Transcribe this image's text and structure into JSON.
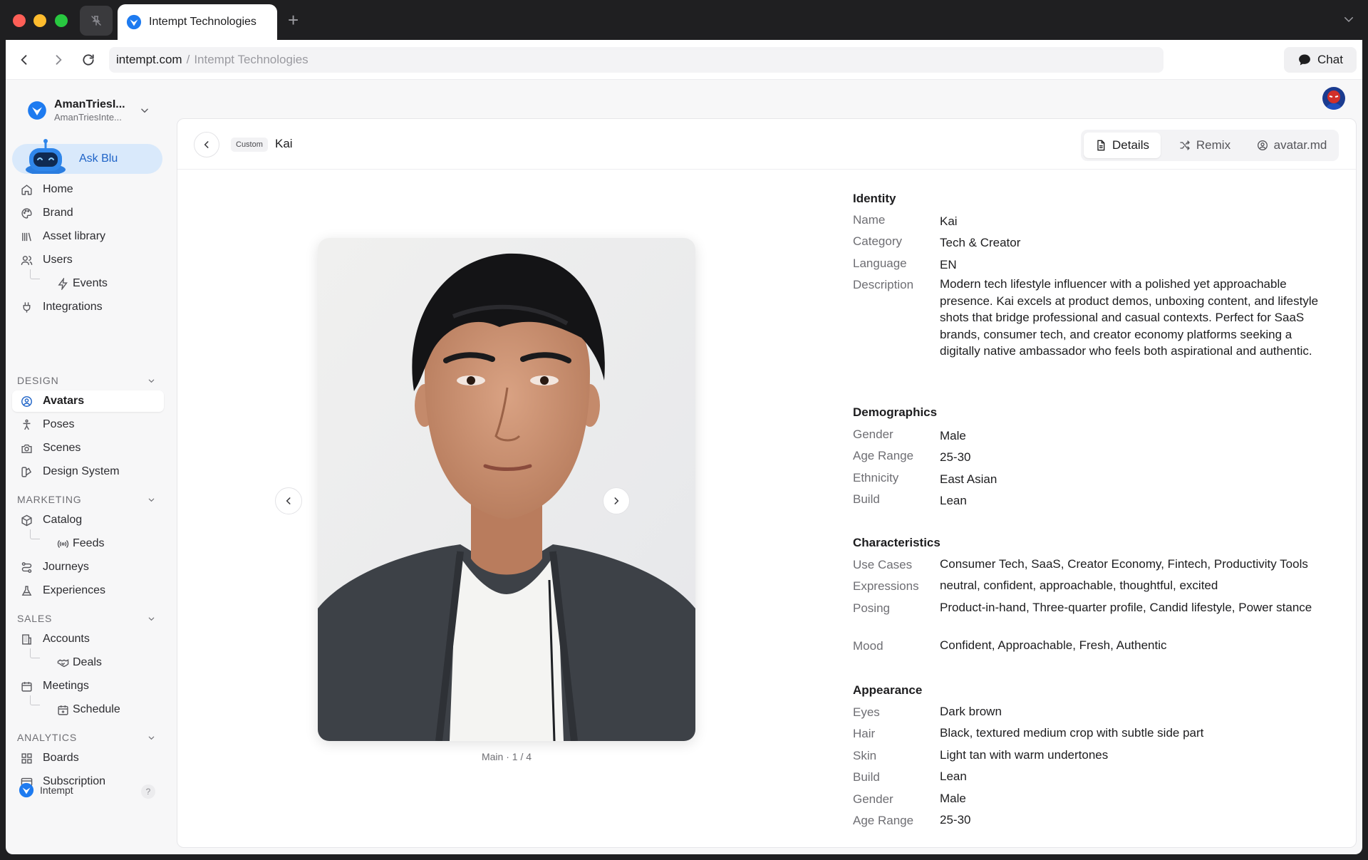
{
  "browser": {
    "tab_title": "Intempt Technologies",
    "url_domain": "intempt.com",
    "url_separator": "/",
    "url_page": "Intempt Technologies",
    "chat_label": "Chat"
  },
  "workspace": {
    "name": "AmanTriesI...",
    "subtitle": "AmanTriesInte..."
  },
  "ask_blu": "Ask Blu",
  "nav": {
    "home": "Home",
    "brand": "Brand",
    "asset_library": "Asset library",
    "users": "Users",
    "events": "Events",
    "integrations": "Integrations",
    "design_section": "DESIGN",
    "avatars": "Avatars",
    "poses": "Poses",
    "scenes": "Scenes",
    "design_system": "Design System",
    "marketing_section": "MARKETING",
    "catalog": "Catalog",
    "feeds": "Feeds",
    "journeys": "Journeys",
    "experiences": "Experiences",
    "sales_section": "SALES",
    "accounts": "Accounts",
    "deals": "Deals",
    "meetings": "Meetings",
    "schedule": "Schedule",
    "analytics_section": "ANALYTICS",
    "boards": "Boards",
    "subscription": "Subscription"
  },
  "footer": {
    "brand": "Intempt",
    "help": "?"
  },
  "header": {
    "badge": "Custom",
    "title": "Kai",
    "tabs": [
      "Details",
      "Remix",
      "avatar.md"
    ],
    "active_tab": "Details"
  },
  "viewer": {
    "caption": "Main · 1 / 4"
  },
  "identity": {
    "title": "Identity",
    "rows": [
      {
        "label": "Name",
        "value": "Kai"
      },
      {
        "label": "Category",
        "value": "Tech & Creator"
      },
      {
        "label": "Language",
        "value": "EN"
      },
      {
        "label": "Description",
        "value": "Modern tech lifestyle influencer with a polished yet approachable presence. Kai excels at product demos, unboxing content, and lifestyle shots that bridge professional and casual contexts. Perfect for SaaS brands, consumer tech, and creator economy platforms seeking a digitally native ambassador who feels both aspirational and authentic."
      }
    ]
  },
  "demographics": {
    "title": "Demographics",
    "rows": [
      {
        "label": "Gender",
        "value": "Male"
      },
      {
        "label": "Age Range",
        "value": "25-30"
      },
      {
        "label": "Ethnicity",
        "value": "East Asian"
      },
      {
        "label": "Build",
        "value": "Lean"
      }
    ]
  },
  "characteristics": {
    "title": "Characteristics",
    "rows": [
      {
        "label": "Use Cases",
        "value": "Consumer Tech, SaaS, Creator Economy, Fintech, Productivity Tools"
      },
      {
        "label": "Expressions",
        "value": "neutral, confident, approachable, thoughtful, excited"
      },
      {
        "label": "Posing",
        "value": "Product-in-hand, Three-quarter profile, Candid lifestyle, Power stance"
      },
      {
        "label": "Mood",
        "value": "Confident, Approachable, Fresh, Authentic"
      }
    ]
  },
  "appearance": {
    "title": "Appearance",
    "rows": [
      {
        "label": "Eyes",
        "value": "Dark brown"
      },
      {
        "label": "Hair",
        "value": "Black, textured medium crop with subtle side part"
      },
      {
        "label": "Skin",
        "value": "Light tan with warm undertones"
      },
      {
        "label": "Build",
        "value": "Lean"
      },
      {
        "label": "Gender",
        "value": "Male"
      },
      {
        "label": "Age Range",
        "value": "25-30"
      }
    ]
  },
  "colors": {
    "accent": "#1e63c7",
    "ask_blu_bg": "#d9e9fb"
  }
}
